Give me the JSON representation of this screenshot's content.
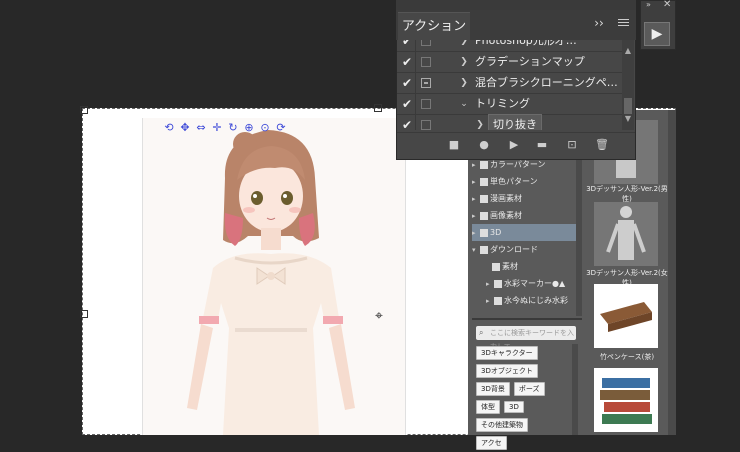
{
  "actions_panel": {
    "tab_label": "アクション",
    "partial_top_item": "Photoshop元形才…",
    "items": [
      {
        "label": "グラデーションマップ",
        "checked": true,
        "dialog": false,
        "expanded": false
      },
      {
        "label": "混合ブラシクローニングペ…",
        "checked": true,
        "dialog": true,
        "expanded": false
      },
      {
        "label": "トリミング",
        "checked": true,
        "dialog": false,
        "expanded": true
      },
      {
        "label": "切り抜き",
        "checked": true,
        "dialog": false,
        "expanded": false,
        "selected": true
      }
    ],
    "toolbar": [
      "stop",
      "record",
      "play",
      "new-set",
      "new-action",
      "delete"
    ]
  },
  "materials_panel": {
    "tree": [
      {
        "label": "カラーパターン"
      },
      {
        "label": "単色パターン"
      },
      {
        "label": "漫画素材"
      },
      {
        "label": "画像素材"
      },
      {
        "label": "3D",
        "selected": true
      },
      {
        "label": "ダウンロード",
        "expanded": true
      },
      {
        "label": "素材"
      },
      {
        "label": "水彩マーカー●▲"
      },
      {
        "label": "水今ぬにじみ水彩"
      }
    ],
    "search_placeholder": "ここに検索キーワードを入力して…",
    "tags": [
      "3Dキャラクター",
      "3Dオブジェクト",
      "3D背景",
      "ポーズ",
      "体型",
      "3D",
      "その他建築物",
      "アクセ"
    ],
    "thumbnails": [
      {
        "label": "3Dデッサン人形-Ver.2(男性)"
      },
      {
        "label": "3Dデッサン人形-Ver.2(女性)"
      },
      {
        "label": "竹ペンケース(茶)"
      },
      {
        "label": ""
      }
    ]
  },
  "mini_panel": {
    "play_icon": "play-icon"
  },
  "colors": {
    "background": "#282828",
    "panel": "#474747",
    "materials": "#5a5a5a",
    "gizmo": "#3f4bd8"
  }
}
